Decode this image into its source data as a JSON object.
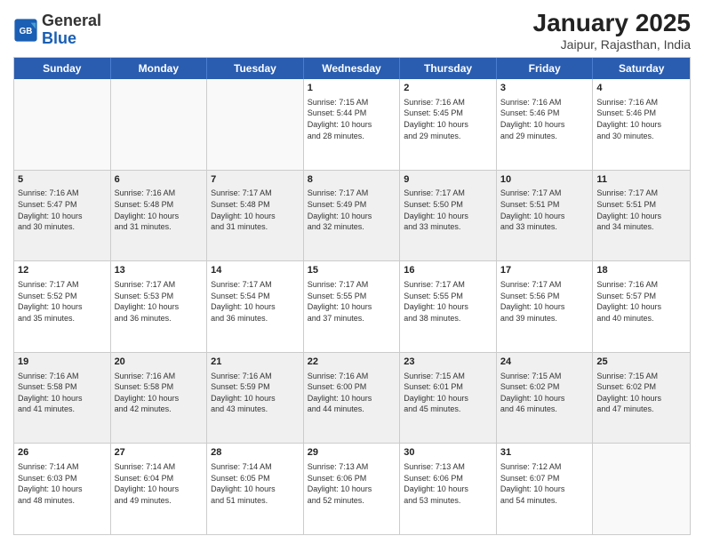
{
  "header": {
    "logo_general": "General",
    "logo_blue": "Blue",
    "month_title": "January 2025",
    "subtitle": "Jaipur, Rajasthan, India"
  },
  "day_headers": [
    "Sunday",
    "Monday",
    "Tuesday",
    "Wednesday",
    "Thursday",
    "Friday",
    "Saturday"
  ],
  "weeks": [
    [
      {
        "day": "",
        "info": "",
        "empty": true
      },
      {
        "day": "",
        "info": "",
        "empty": true
      },
      {
        "day": "",
        "info": "",
        "empty": true
      },
      {
        "day": "1",
        "info": "Sunrise: 7:15 AM\nSunset: 5:44 PM\nDaylight: 10 hours\nand 28 minutes.",
        "empty": false
      },
      {
        "day": "2",
        "info": "Sunrise: 7:16 AM\nSunset: 5:45 PM\nDaylight: 10 hours\nand 29 minutes.",
        "empty": false
      },
      {
        "day": "3",
        "info": "Sunrise: 7:16 AM\nSunset: 5:46 PM\nDaylight: 10 hours\nand 29 minutes.",
        "empty": false
      },
      {
        "day": "4",
        "info": "Sunrise: 7:16 AM\nSunset: 5:46 PM\nDaylight: 10 hours\nand 30 minutes.",
        "empty": false
      }
    ],
    [
      {
        "day": "5",
        "info": "Sunrise: 7:16 AM\nSunset: 5:47 PM\nDaylight: 10 hours\nand 30 minutes.",
        "empty": false
      },
      {
        "day": "6",
        "info": "Sunrise: 7:16 AM\nSunset: 5:48 PM\nDaylight: 10 hours\nand 31 minutes.",
        "empty": false
      },
      {
        "day": "7",
        "info": "Sunrise: 7:17 AM\nSunset: 5:48 PM\nDaylight: 10 hours\nand 31 minutes.",
        "empty": false
      },
      {
        "day": "8",
        "info": "Sunrise: 7:17 AM\nSunset: 5:49 PM\nDaylight: 10 hours\nand 32 minutes.",
        "empty": false
      },
      {
        "day": "9",
        "info": "Sunrise: 7:17 AM\nSunset: 5:50 PM\nDaylight: 10 hours\nand 33 minutes.",
        "empty": false
      },
      {
        "day": "10",
        "info": "Sunrise: 7:17 AM\nSunset: 5:51 PM\nDaylight: 10 hours\nand 33 minutes.",
        "empty": false
      },
      {
        "day": "11",
        "info": "Sunrise: 7:17 AM\nSunset: 5:51 PM\nDaylight: 10 hours\nand 34 minutes.",
        "empty": false
      }
    ],
    [
      {
        "day": "12",
        "info": "Sunrise: 7:17 AM\nSunset: 5:52 PM\nDaylight: 10 hours\nand 35 minutes.",
        "empty": false
      },
      {
        "day": "13",
        "info": "Sunrise: 7:17 AM\nSunset: 5:53 PM\nDaylight: 10 hours\nand 36 minutes.",
        "empty": false
      },
      {
        "day": "14",
        "info": "Sunrise: 7:17 AM\nSunset: 5:54 PM\nDaylight: 10 hours\nand 36 minutes.",
        "empty": false
      },
      {
        "day": "15",
        "info": "Sunrise: 7:17 AM\nSunset: 5:55 PM\nDaylight: 10 hours\nand 37 minutes.",
        "empty": false
      },
      {
        "day": "16",
        "info": "Sunrise: 7:17 AM\nSunset: 5:55 PM\nDaylight: 10 hours\nand 38 minutes.",
        "empty": false
      },
      {
        "day": "17",
        "info": "Sunrise: 7:17 AM\nSunset: 5:56 PM\nDaylight: 10 hours\nand 39 minutes.",
        "empty": false
      },
      {
        "day": "18",
        "info": "Sunrise: 7:16 AM\nSunset: 5:57 PM\nDaylight: 10 hours\nand 40 minutes.",
        "empty": false
      }
    ],
    [
      {
        "day": "19",
        "info": "Sunrise: 7:16 AM\nSunset: 5:58 PM\nDaylight: 10 hours\nand 41 minutes.",
        "empty": false
      },
      {
        "day": "20",
        "info": "Sunrise: 7:16 AM\nSunset: 5:58 PM\nDaylight: 10 hours\nand 42 minutes.",
        "empty": false
      },
      {
        "day": "21",
        "info": "Sunrise: 7:16 AM\nSunset: 5:59 PM\nDaylight: 10 hours\nand 43 minutes.",
        "empty": false
      },
      {
        "day": "22",
        "info": "Sunrise: 7:16 AM\nSunset: 6:00 PM\nDaylight: 10 hours\nand 44 minutes.",
        "empty": false
      },
      {
        "day": "23",
        "info": "Sunrise: 7:15 AM\nSunset: 6:01 PM\nDaylight: 10 hours\nand 45 minutes.",
        "empty": false
      },
      {
        "day": "24",
        "info": "Sunrise: 7:15 AM\nSunset: 6:02 PM\nDaylight: 10 hours\nand 46 minutes.",
        "empty": false
      },
      {
        "day": "25",
        "info": "Sunrise: 7:15 AM\nSunset: 6:02 PM\nDaylight: 10 hours\nand 47 minutes.",
        "empty": false
      }
    ],
    [
      {
        "day": "26",
        "info": "Sunrise: 7:14 AM\nSunset: 6:03 PM\nDaylight: 10 hours\nand 48 minutes.",
        "empty": false
      },
      {
        "day": "27",
        "info": "Sunrise: 7:14 AM\nSunset: 6:04 PM\nDaylight: 10 hours\nand 49 minutes.",
        "empty": false
      },
      {
        "day": "28",
        "info": "Sunrise: 7:14 AM\nSunset: 6:05 PM\nDaylight: 10 hours\nand 51 minutes.",
        "empty": false
      },
      {
        "day": "29",
        "info": "Sunrise: 7:13 AM\nSunset: 6:06 PM\nDaylight: 10 hours\nand 52 minutes.",
        "empty": false
      },
      {
        "day": "30",
        "info": "Sunrise: 7:13 AM\nSunset: 6:06 PM\nDaylight: 10 hours\nand 53 minutes.",
        "empty": false
      },
      {
        "day": "31",
        "info": "Sunrise: 7:12 AM\nSunset: 6:07 PM\nDaylight: 10 hours\nand 54 minutes.",
        "empty": false
      },
      {
        "day": "",
        "info": "",
        "empty": true
      }
    ]
  ]
}
